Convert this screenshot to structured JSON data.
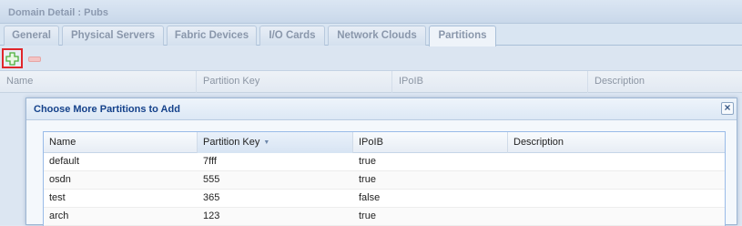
{
  "window": {
    "title": "Domain Detail : Pubs"
  },
  "tabs": [
    {
      "label": "General"
    },
    {
      "label": "Physical Servers"
    },
    {
      "label": "Fabric Devices"
    },
    {
      "label": "I/O Cards"
    },
    {
      "label": "Network Clouds"
    },
    {
      "label": "Partitions"
    }
  ],
  "active_tab": "Partitions",
  "toolbar": {
    "add_icon": "add-plus-icon",
    "remove_icon": "remove-minus-icon"
  },
  "main_grid": {
    "columns": [
      "Name",
      "Partition Key",
      "IPoIB",
      "Description"
    ]
  },
  "dialog": {
    "title": "Choose More Partitions to Add",
    "close_label": "×",
    "grid": {
      "columns": [
        "Name",
        "Partition Key",
        "IPoIB",
        "Description"
      ],
      "sorted_column": "Partition Key",
      "rows": [
        {
          "name": "default",
          "key": "7fff",
          "ipoib": "true",
          "description": ""
        },
        {
          "name": "osdn",
          "key": "555",
          "ipoib": "true",
          "description": ""
        },
        {
          "name": "test",
          "key": "365",
          "ipoib": "false",
          "description": ""
        },
        {
          "name": "arch",
          "key": "123",
          "ipoib": "true",
          "description": ""
        }
      ]
    }
  },
  "colors": {
    "accent": "#15428b",
    "highlight_border": "#e0262b",
    "add_green": "#4caf3a"
  }
}
